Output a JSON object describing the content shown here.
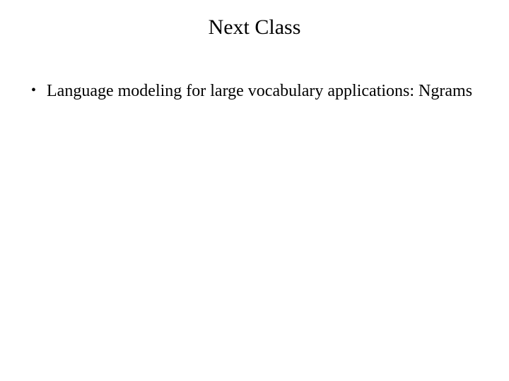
{
  "slide": {
    "title": "Next Class",
    "bullets": [
      "Language modeling for large vocabulary applications: Ngrams"
    ]
  }
}
